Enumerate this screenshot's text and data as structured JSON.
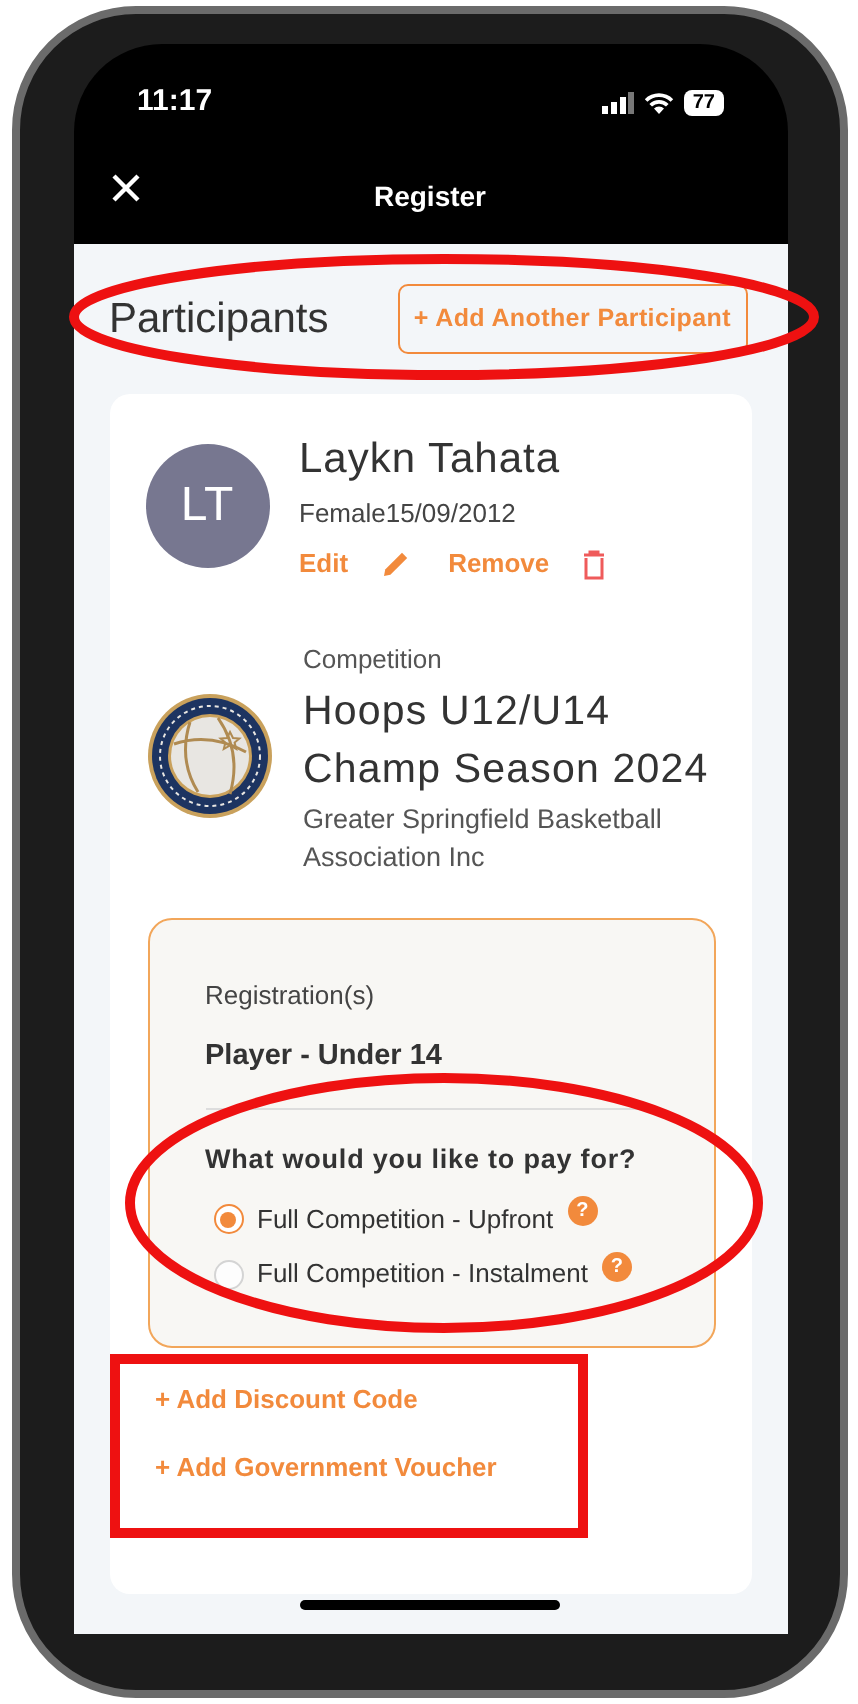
{
  "status_bar": {
    "time": "11:17",
    "battery": "77"
  },
  "window": {
    "title": "Register"
  },
  "participants_header": {
    "title": "Participants",
    "add_button": "+ Add Another Participant"
  },
  "participant": {
    "initials": "LT",
    "name": "Laykn Tahata",
    "details": "Female15/09/2012",
    "actions": [
      {
        "kind": "edit",
        "label": "Edit"
      },
      {
        "kind": "remove",
        "label": "Remove"
      }
    ]
  },
  "competition": {
    "label": "Competition",
    "title": "Hoops U12/U14 Champ Season 2024",
    "organisation": "Greater Springfield Basketball Association Inc"
  },
  "registration": {
    "label": "Registration(s)",
    "value": "Player - Under 14",
    "question": "What would you like to pay for?",
    "options": [
      {
        "label": "Full Competition - Upfront",
        "selected": true,
        "help": "?"
      },
      {
        "label": "Full Competition - Instalment",
        "selected": false,
        "help": "?"
      }
    ]
  },
  "links": [
    "+ Add Discount Code",
    "+ Add Government Voucher"
  ]
}
